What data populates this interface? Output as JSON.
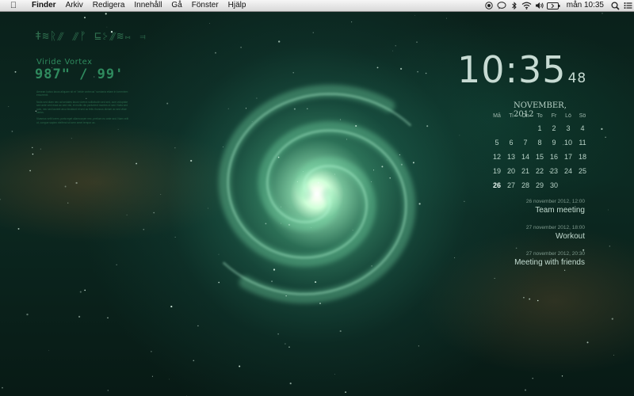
{
  "menubar": {
    "apple_icon": "apple-logo",
    "app_name": "Finder",
    "items": [
      "Arkiv",
      "Redigera",
      "Innehåll",
      "Gå",
      "Fönster",
      "Hjälp"
    ],
    "status_icons": [
      "record-icon",
      "chat-bubble-icon",
      "bluetooth-icon",
      "wifi-icon",
      "volume-icon",
      "battery-icon"
    ],
    "clock": "mån 10:35",
    "search_icon": "spotlight-search",
    "list_icon": "notification-center"
  },
  "widget": {
    "glyphs": "ǂ≋ᚱ⫻ ⫻ᚠ ⊑⊱⫻≋⋈ ⫤",
    "title": "Viride Vortex",
    "reading": "987\" / 99'",
    "lore": [
      "Aenean luctus lacus aliquam sit et \"viride vortexus\" scrutaria etiam in torrentem exsurrexit.",
      "Nulla sed diam nec ad sedales lacus viverra sollicitudin sed sed, cum voluptate sed ante veni esse ac sed nisl, et mollis dis parturient montes ut sed. Nulla sed quis, nec sed laoreet arcu tincidunt et sed ac felis rhoncus dictum ac sed vitae varius.",
      "Vivamus velit lorem, porta eget ullamcorper nec, pretium eu ante sed. Nam velit ut, congue sapien eleifend sit sem amet tempor ac."
    ]
  },
  "clock": {
    "time": "10:35",
    "seconds": "48"
  },
  "calendar": {
    "title": "NOVEMBER, 2012",
    "weekdays": [
      "Må",
      "Ti",
      "On",
      "To",
      "Fr",
      "Lö",
      "Sö"
    ],
    "weeks": [
      [
        "",
        "",
        "",
        "1",
        "2",
        "3",
        "4"
      ],
      [
        "5",
        "6",
        "7",
        "8",
        "9",
        "10",
        "11"
      ],
      [
        "12",
        "13",
        "14",
        "15",
        "16",
        "17",
        "18"
      ],
      [
        "19",
        "20",
        "21",
        "22",
        "23",
        "24",
        "25"
      ],
      [
        "26",
        "27",
        "28",
        "29",
        "30",
        "",
        ""
      ]
    ],
    "today": "26"
  },
  "events": [
    {
      "date": "26 november 2012, 12:00",
      "title": "Team meeting"
    },
    {
      "date": "27 november 2012, 18:00",
      "title": "Workout"
    },
    {
      "date": "27 november 2012, 20:30",
      "title": "Meeting with friends"
    }
  ]
}
